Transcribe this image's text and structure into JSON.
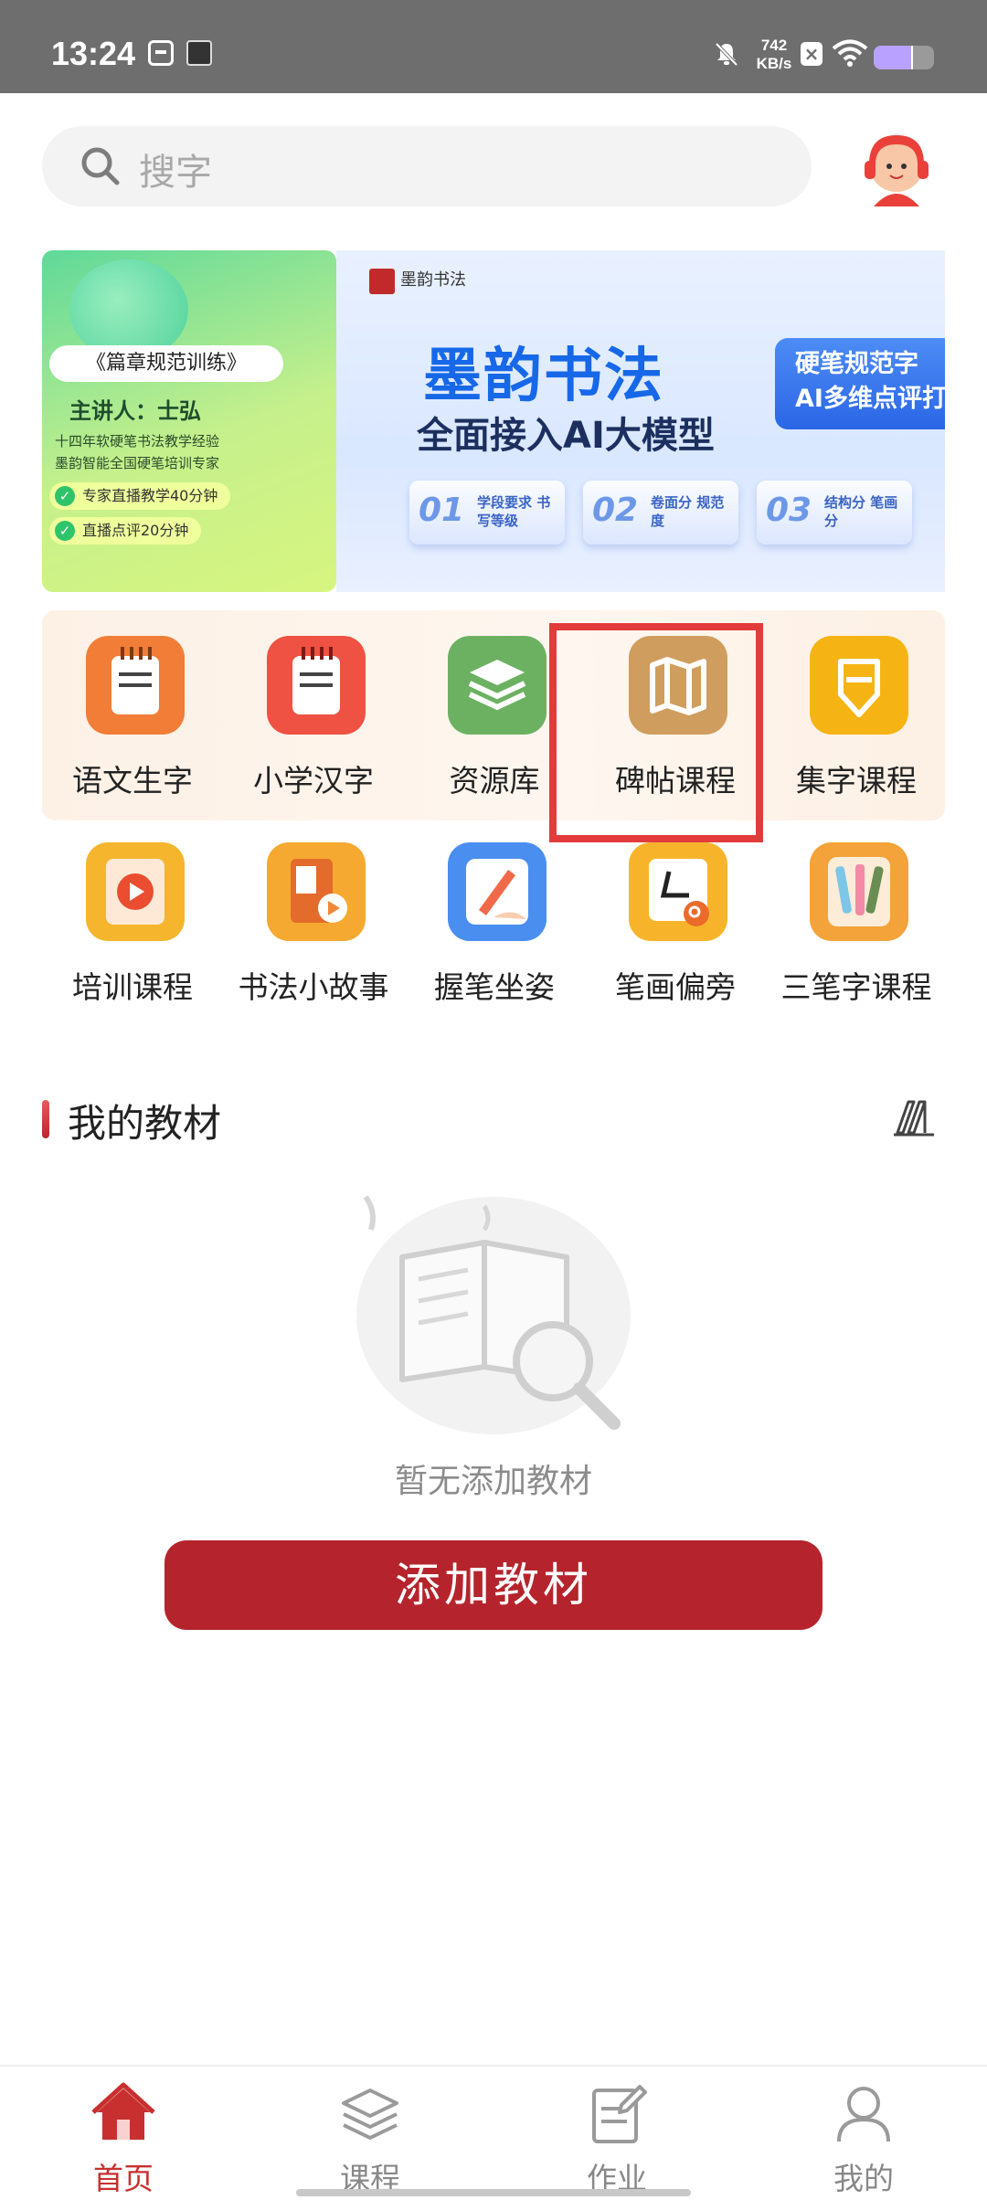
{
  "status_bar": {
    "time": "13:24",
    "net_speed_value": "742",
    "net_speed_unit": "KB/s",
    "battery_level": 0.65
  },
  "search": {
    "placeholder": "搜字"
  },
  "banner": {
    "promo": {
      "title": "《篇章规范训练》",
      "lecturer": "主讲人：士弘",
      "line1": "十四年软硬笔书法教学经验",
      "line2": "墨韵智能全国硬笔培训专家",
      "pill1": "专家直播教学40分钟",
      "pill2": "直播点评20分钟"
    },
    "ad": {
      "title": "墨韵书法",
      "subtitle": "全面接入AI大模型",
      "tag_line1": "硬笔规范字",
      "tag_line2": "AI多维点评打",
      "steps": [
        {
          "num": "01",
          "text": "学段要求 书写等级"
        },
        {
          "num": "02",
          "text": "卷面分 规范度"
        },
        {
          "num": "03",
          "text": "结构分 笔画分"
        }
      ]
    }
  },
  "features": [
    {
      "label": "语文生字",
      "icon": "yuwen-book-icon",
      "color": "#f27d37"
    },
    {
      "label": "小学汉字",
      "icon": "hanzi-book-icon",
      "color": "#ef5143"
    },
    {
      "label": "资源库",
      "icon": "layers-icon",
      "color": "#6cb162"
    },
    {
      "label": "碑帖课程",
      "icon": "map-icon",
      "color": "#cf9d5e"
    },
    {
      "label": "集字课程",
      "icon": "pen-nib-icon",
      "color": "#f6b414"
    },
    {
      "label": "培训课程",
      "icon": "play-book-icon",
      "color": "#f5b62d"
    },
    {
      "label": "书法小故事",
      "icon": "story-book-icon",
      "color": "#f5a931"
    },
    {
      "label": "握笔坐姿",
      "icon": "pen-hand-icon",
      "color": "#4a8ef0"
    },
    {
      "label": "笔画偏旁",
      "icon": "stroke-search-icon",
      "color": "#f7b42b"
    },
    {
      "label": "三笔字课程",
      "icon": "brush-pens-icon",
      "color": "#f4a23a"
    }
  ],
  "section": {
    "title": "我的教材"
  },
  "empty": {
    "text": "暂无添加教材"
  },
  "add_button": {
    "label": "添加教材"
  },
  "tabs": [
    {
      "label": "首页",
      "icon": "home-icon",
      "active": true
    },
    {
      "label": "课程",
      "icon": "layers-outline-icon",
      "active": false
    },
    {
      "label": "作业",
      "icon": "homework-icon",
      "active": false
    },
    {
      "label": "我的",
      "icon": "profile-icon",
      "active": false
    }
  ],
  "colors": {
    "primary": "#b5242c",
    "highlight_box": "#e23b3b",
    "status_bar": "#6e6e6e"
  }
}
